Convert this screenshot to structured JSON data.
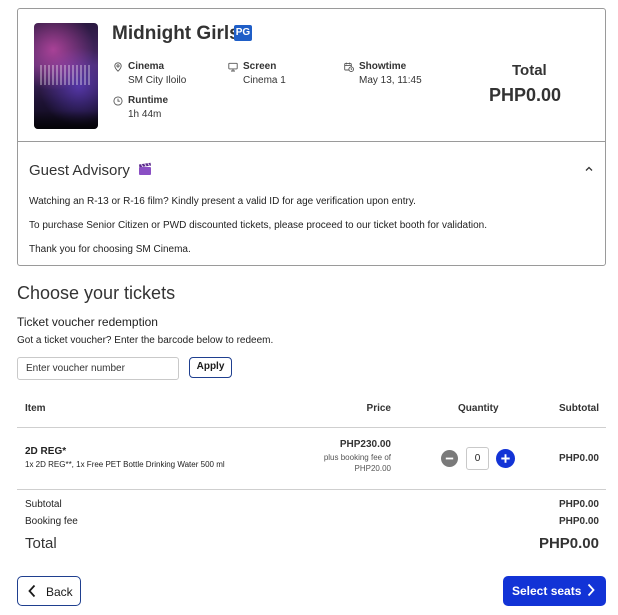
{
  "movie": {
    "title": "Midnight Girls",
    "rating": "PG",
    "cinema_label": "Cinema",
    "cinema_value": "SM City Iloilo",
    "screen_label": "Screen",
    "screen_value": "Cinema 1",
    "showtime_label": "Showtime",
    "showtime_value": "May 13, 11:45",
    "runtime_label": "Runtime",
    "runtime_value": "1h 44m",
    "total_label": "Total",
    "total_value": "PHP0.00",
    "icons": {
      "poster": "movie-poster-image",
      "cinema": "location-pin-icon",
      "screen": "monitor-icon",
      "showtime": "calendar-clock-icon",
      "runtime": "clock-icon"
    }
  },
  "advisory": {
    "title": "Guest Advisory",
    "icons": {
      "title": "clapperboard-icon",
      "toggle": "chevron-up-icon"
    },
    "lines": [
      "Watching an R-13 or R-16 film? Kindly present a valid ID for age verification upon entry.",
      "To purchase Senior Citizen or PWD discounted tickets, please proceed to our ticket booth for validation.",
      "Thank you for choosing SM Cinema."
    ]
  },
  "tickets": {
    "heading": "Choose your tickets",
    "voucher_heading": "Ticket voucher redemption",
    "voucher_help": "Got a ticket voucher? Enter the barcode below to redeem.",
    "voucher_value": "",
    "voucher_placeholder": "Enter voucher number",
    "apply_label": "Apply",
    "columns": {
      "item": "Item",
      "price": "Price",
      "quantity": "Quantity",
      "subtotal": "Subtotal"
    },
    "items": [
      {
        "name": "2D REG*",
        "description": "1x 2D REG**, 1x Free PET Bottle Drinking Water 500 ml",
        "price": "PHP230.00",
        "fee_line1": "plus booking fee of",
        "fee_line2": "PHP20.00",
        "quantity": "0",
        "subtotal": "PHP0.00"
      }
    ],
    "qty_icons": {
      "decrease": "minus-circle-icon",
      "increase": "plus-circle-icon"
    }
  },
  "summary": {
    "subtotal_label": "Subtotal",
    "subtotal_value": "PHP0.00",
    "booking_fee_label": "Booking fee",
    "booking_fee_value": "PHP0.00",
    "total_label": "Total",
    "total_value": "PHP0.00"
  },
  "actions": {
    "back_label": "Back",
    "next_label": "Select seats",
    "icons": {
      "back": "chevron-left-icon",
      "next": "chevron-right-icon"
    }
  },
  "colors": {
    "primary": "#1233d6",
    "rating_badge": "#1f5ec7",
    "border": "#9a9a9a"
  }
}
